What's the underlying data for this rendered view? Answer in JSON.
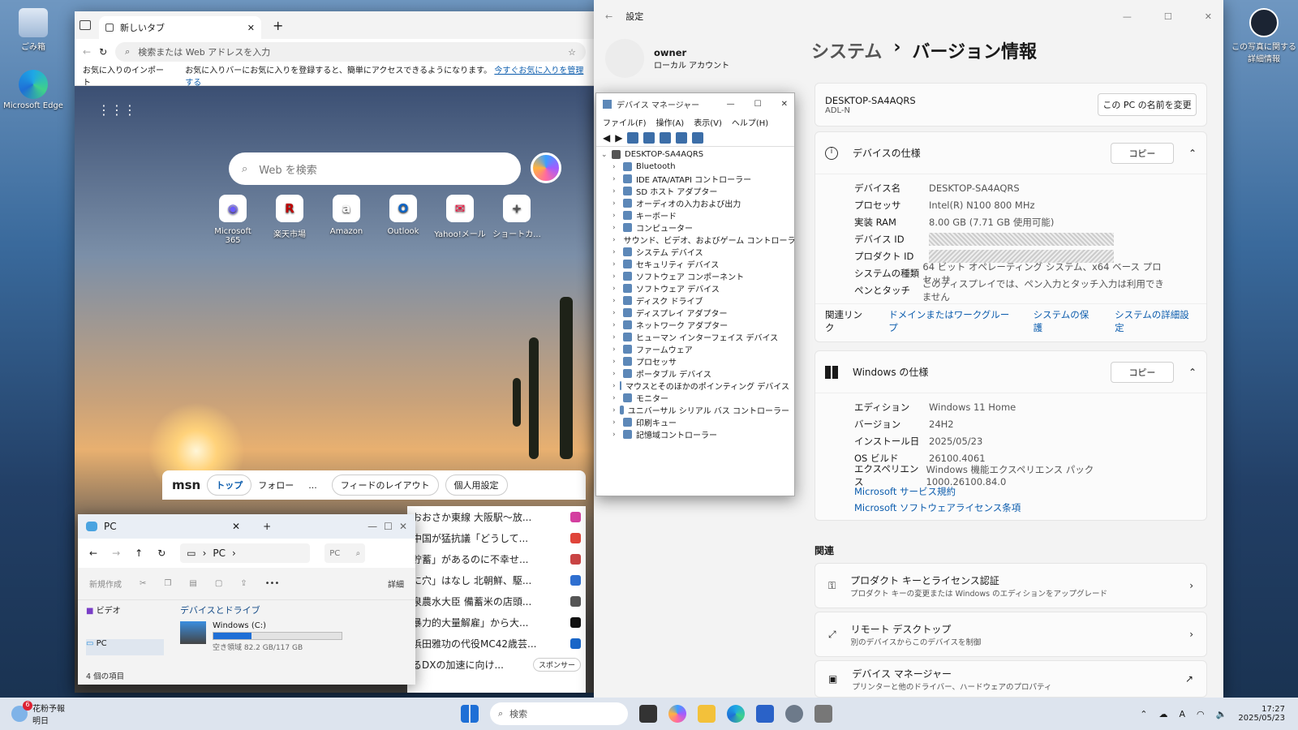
{
  "desktop": {
    "recycle_bin": "ごみ箱",
    "edge_icon": "Microsoft Edge",
    "photo_info": "この写真に関する詳細情報"
  },
  "browser": {
    "tab_title": "新しいタブ",
    "address_placeholder": "検索または Web アドレスを入力",
    "fav_import": "お気に入りのインポート",
    "fav_message": "お気に入りバーにお気に入りを登録すると、簡単にアクセスできるようになります。",
    "fav_manage": "今すぐお気に入りを管理する",
    "search_placeholder": "Web を検索",
    "shortcuts": [
      "Microsoft 365",
      "楽天市場",
      "Amazon",
      "Outlook",
      "Yahoo!メール",
      "ショートカ..."
    ],
    "msn": {
      "logo": "msn",
      "tabs": [
        "トップ",
        "フォロー"
      ],
      "more": "...",
      "feed_layout": "フィードのレイアウト",
      "personalize": "個人用設定"
    },
    "news": [
      "おおさか東線 大阪駅〜放...",
      "中国が猛抗議「どうして...",
      "貯蓄」があるのに不幸せ...",
      "に穴」はなし 北朝鮮、駆...",
      "泉農水大臣 備蓄米の店頭...",
      "暴力的大量解雇」から大...",
      "浜田雅功の代役MC42歳芸...",
      "るDXの加速に向け..."
    ],
    "sponsor": "スポンサー"
  },
  "explorer": {
    "tab_title": "PC",
    "path": "PC",
    "search_scope": "PC",
    "new_label": "新規作成",
    "details_label": "詳細",
    "nav_video": "ビデオ",
    "nav_pc": "PC",
    "section": "デバイスとドライブ",
    "drive_name": "Windows (C:)",
    "drive_free": "空き領域 82.2 GB/117 GB",
    "drive_used_fraction": 0.3,
    "status": "4 個の項目"
  },
  "device_manager": {
    "title": "デバイス マネージャー",
    "menu": [
      "ファイル(F)",
      "操作(A)",
      "表示(V)",
      "ヘルプ(H)"
    ],
    "root": "DESKTOP-SA4AQRS",
    "items": [
      "Bluetooth",
      "IDE ATA/ATAPI コントローラー",
      "SD ホスト アダプター",
      "オーディオの入力および出力",
      "キーボード",
      "コンピューター",
      "サウンド、ビデオ、およびゲーム コントローラー",
      "システム デバイス",
      "セキュリティ デバイス",
      "ソフトウェア コンポーネント",
      "ソフトウェア デバイス",
      "ディスク ドライブ",
      "ディスプレイ アダプター",
      "ネットワーク アダプター",
      "ヒューマン インターフェイス デバイス",
      "ファームウェア",
      "プロセッサ",
      "ポータブル デバイス",
      "マウスとそのほかのポインティング デバイス",
      "モニター",
      "ユニバーサル シリアル バス コントローラー",
      "印刷キュー",
      "記憶域コントローラー"
    ]
  },
  "settings": {
    "app_title": "設定",
    "user_name": "owner",
    "user_type": "ローカル アカウント",
    "breadcrumb_parent": "システム",
    "breadcrumb_sep": "›",
    "breadcrumb_current": "バージョン情報",
    "pc_name": "DESKTOP-SA4AQRS",
    "pc_model": "ADL-N",
    "rename_button": "この PC の名前を変更",
    "device_spec_title": "デバイスの仕様",
    "copy": "コピー",
    "device_spec": [
      {
        "k": "デバイス名",
        "v": "DESKTOP-SA4AQRS"
      },
      {
        "k": "プロセッサ",
        "v": "Intel(R) N100   800 MHz"
      },
      {
        "k": "実装 RAM",
        "v": "8.00 GB (7.71 GB 使用可能)"
      },
      {
        "k": "デバイス ID",
        "v": ""
      },
      {
        "k": "プロダクト ID",
        "v": ""
      },
      {
        "k": "システムの種類",
        "v": "64 ビット オペレーティング システム、x64 ベース プロセッサ"
      },
      {
        "k": "ペンとタッチ",
        "v": "このディスプレイでは、ペン入力とタッチ入力は利用できません"
      }
    ],
    "related_links_label": "関連リンク",
    "related_links": [
      "ドメインまたはワークグループ",
      "システムの保護",
      "システムの詳細設定"
    ],
    "windows_spec_title": "Windows の仕様",
    "windows_spec": [
      {
        "k": "エディション",
        "v": "Windows 11 Home"
      },
      {
        "k": "バージョン",
        "v": "24H2"
      },
      {
        "k": "インストール日",
        "v": "2025/05/23"
      },
      {
        "k": "OS ビルド",
        "v": "26100.4061"
      },
      {
        "k": "エクスペリエンス",
        "v": "Windows 機能エクスペリエンス パック 1000.26100.84.0"
      }
    ],
    "ms_service": "Microsoft サービス規約",
    "ms_license": "Microsoft ソフトウェアライセンス条項",
    "related_header": "関連",
    "related_items": [
      {
        "title": "プロダクト キーとライセンス認証",
        "sub": "プロダクト キーの変更または Windows のエディションをアップグレード"
      },
      {
        "title": "リモート デスクトップ",
        "sub": "別のデバイスからこのデバイスを制御"
      },
      {
        "title": "デバイス マネージャー",
        "sub": "プリンターと他のドライバー、ハードウェアのプロパティ"
      }
    ]
  },
  "taskbar": {
    "weather_badge": "6",
    "weather_title": "花粉予報",
    "weather_sub": "明日",
    "search_placeholder": "検索",
    "ime": "A",
    "time": "17:27",
    "date": "2025/05/23"
  },
  "colors": {
    "accent": "#0b5cad",
    "drive_bar": "#1f6fd6"
  }
}
